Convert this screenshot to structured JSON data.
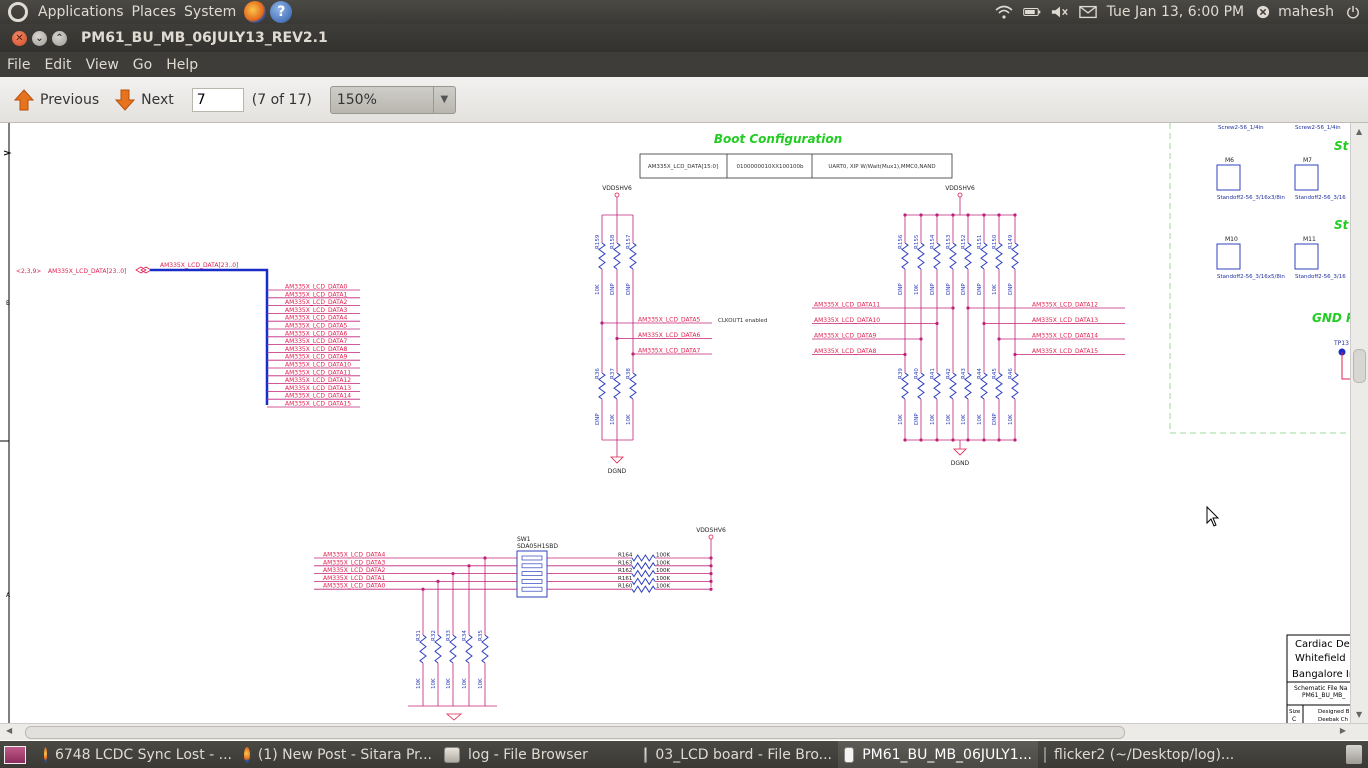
{
  "top_panel": {
    "applications": "Applications",
    "places": "Places",
    "system": "System",
    "datetime": "Tue Jan 13,  6:00 PM",
    "user": "mahesh"
  },
  "window": {
    "title": "PM61_BU_MB_06JULY13_REV2.1"
  },
  "menu": {
    "file": "File",
    "edit": "Edit",
    "view": "View",
    "go": "Go",
    "help": "Help"
  },
  "toolbar": {
    "previous": "Previous",
    "next": "Next",
    "page_value": "7",
    "page_count": "(7 of 17)",
    "zoom": "150%"
  },
  "schematic": {
    "boot_title": "Boot Configuration",
    "boot_table": [
      "AM335X_LCD_DATA[15:0]",
      "0100000010XX100100b",
      "UART0, XIP W/Wait(Mux1),MMC0,NAND"
    ],
    "rail_label": "VDDSHV6",
    "ground_label": "DGND",
    "bus_name": "AM335X_LCD_DATA[23..0]",
    "bus_port": "<2,3,9>",
    "bus_ref": "AM335X_LCD_DATA[23..0]",
    "bus_taps": [
      "AM335X_LCD_DATA0",
      "AM335X_LCD_DATA1",
      "AM335X_LCD_DATA2",
      "AM335X_LCD_DATA3",
      "AM335X_LCD_DATA4",
      "AM335X_LCD_DATA5",
      "AM335X_LCD_DATA6",
      "AM335X_LCD_DATA7",
      "AM335X_LCD_DATA8",
      "AM335X_LCD_DATA9",
      "AM335X_LCD_DATA10",
      "AM335X_LCD_DATA11",
      "AM335X_LCD_DATA12",
      "AM335X_LCD_DATA13",
      "AM335X_LCD_DATA14",
      "AM335X_LCD_DATA15"
    ],
    "clkout_note": "CLKOUT1 enabled",
    "left_group_upper": [
      "R159",
      "R158",
      "R157"
    ],
    "left_group_upper_vals": [
      "10K",
      "DNP",
      "DNP"
    ],
    "left_group_lower": [
      "R36",
      "R37",
      "R38"
    ],
    "left_group_lower_vals": [
      "DNP",
      "10K",
      "10K"
    ],
    "left_group_nets": [
      "AM335X_LCD_DATA5",
      "AM335X_LCD_DATA6",
      "AM335X_LCD_DATA7"
    ],
    "right_group_upper": [
      "R156",
      "R155",
      "R154",
      "R153",
      "R152",
      "R151",
      "R150",
      "R149"
    ],
    "right_group_upper_vals": [
      "DNP",
      "10K",
      "DNP",
      "DNP",
      "DNP",
      "DNP",
      "10K",
      "DNP"
    ],
    "right_group_lower": [
      "R39",
      "R40",
      "R41",
      "R42",
      "R43",
      "R44",
      "R45",
      "R46"
    ],
    "right_group_lower_vals": [
      "10K",
      "DNP",
      "10K",
      "10K",
      "10K",
      "10K",
      "DNP",
      "10K"
    ],
    "right_left_nets": [
      "AM335X_LCD_DATA11",
      "AM335X_LCD_DATA10",
      "AM335X_LCD_DATA9",
      "AM335X_LCD_DATA8"
    ],
    "right_right_nets": [
      "AM335X_LCD_DATA12",
      "AM335X_LCD_DATA13",
      "AM335X_LCD_DATA14",
      "AM335X_LCD_DATA15"
    ],
    "switch_ref": "SW1",
    "switch_part": "SDA05H1SBD",
    "switch_nets": [
      "AM335X_LCD_DATA4",
      "AM335X_LCD_DATA3",
      "AM335X_LCD_DATA2",
      "AM335X_LCD_DATA1",
      "AM335X_LCD_DATA0"
    ],
    "pullup_refs": [
      "R164",
      "R163",
      "R162",
      "R161",
      "R160"
    ],
    "pullup_val": "100K",
    "pulldown_refs": [
      "R31",
      "R32",
      "R33",
      "R34",
      "R35"
    ],
    "pulldown_val": "10K",
    "mounts": [
      {
        "ref": "M6",
        "desc": "Standoff2-56_3/16x3/8in"
      },
      {
        "ref": "M7",
        "desc": "Standoff2-56_3/16"
      },
      {
        "ref": "M10",
        "desc": "Standoff2-56_3/16x5/8in"
      },
      {
        "ref": "M11",
        "desc": "Standoff2-56_3/16"
      }
    ],
    "screw_labels": [
      "Screw2-56_1/4in",
      "Screw2-56_1/4in"
    ],
    "side_titles": [
      "St",
      "St",
      "GND P"
    ],
    "testpoint": "TP13",
    "title_block": [
      "Cardiac Des",
      "Whitefield",
      "Bangalore In",
      "Schematic File Na",
      "PM61_BU_MB_",
      "Size",
      "C",
      "Designed B",
      "Deebak Ch"
    ],
    "zone_labels": [
      "B",
      "A"
    ]
  },
  "taskbar": [
    {
      "label": "6748 LCDC Sync Lost - ...",
      "icon": "firefox-icon"
    },
    {
      "label": "(1) New Post - Sitara Pr...",
      "icon": "firefox-icon"
    },
    {
      "label": "log - File Browser",
      "icon": "folder-icon"
    },
    {
      "label": "03_LCD board - File Bro...",
      "icon": "folder-icon"
    },
    {
      "label": "PM61_BU_MB_06JULY1...",
      "icon": "document-icon"
    },
    {
      "label": "flicker2 (~/Desktop/log)...",
      "icon": "text-editor-icon"
    }
  ],
  "colors": {
    "panel": "#3c3b37",
    "net_red": "#e0204f",
    "wire": "#c0207a",
    "bus_blue": "#1a2cc8",
    "resistor": "#3040c0",
    "title_green": "#22cc22"
  }
}
